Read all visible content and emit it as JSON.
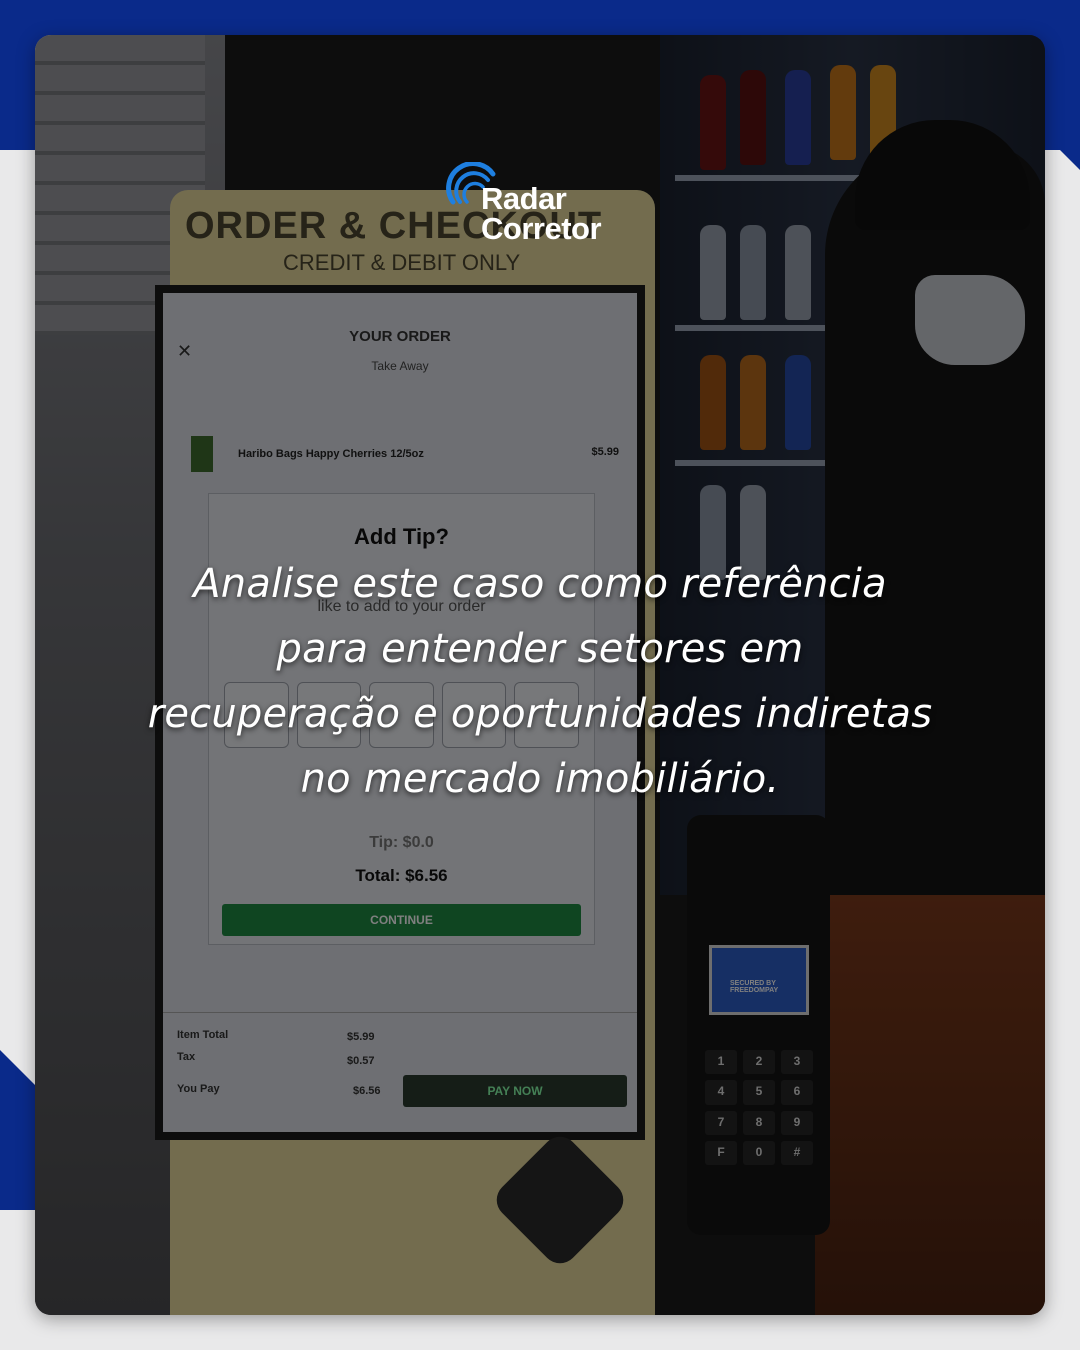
{
  "brand": {
    "logo_line1": "Radar",
    "logo_line2": "Corretor",
    "accent_color": "#0a2a8a",
    "logo_ring_color": "#1e7fe0"
  },
  "headline": "Analise este caso como referência para entender setores em recuperação e oportunidades indiretas no mercado imobiliário.",
  "photo": {
    "kiosk_title": "ORDER & CHECKOUT",
    "kiosk_subtitle": "CREDIT & DEBIT ONLY",
    "screen": {
      "order_title": "YOUR ORDER",
      "order_mode": "Take Away",
      "item_name": "Haribo Bags Happy Cherries 12/5oz",
      "item_price": "$5.99",
      "modal_title": "Add Tip?",
      "modal_line": "like to add to your order",
      "tip_label": "Tip: $0.0",
      "total_label": "Total: $6.56",
      "continue_label": "CONTINUE",
      "summary": {
        "item_total_label": "Item Total",
        "item_total_value": "$5.99",
        "tax_label": "Tax",
        "tax_value": "$0.57",
        "you_pay_label": "You Pay",
        "you_pay_value": "$6.56",
        "pay_now_label": "PAY NOW"
      }
    },
    "terminal": {
      "screen_text": "SECURED BY FREEDOMPAY",
      "keys": [
        "1",
        "2",
        "3",
        "4",
        "5",
        "6",
        "7",
        "8",
        "9",
        "F",
        "0",
        "#"
      ]
    }
  }
}
